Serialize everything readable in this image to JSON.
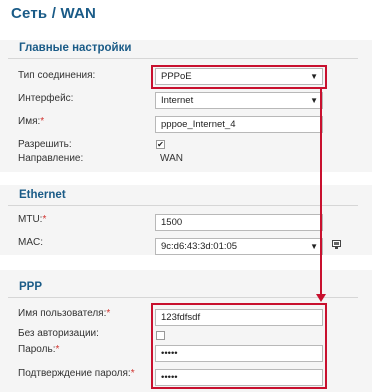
{
  "header": {
    "title": "Сеть /  WAN"
  },
  "main_settings": {
    "title": "Главные настройки",
    "connection_type": {
      "label": "Тип соединения:",
      "value": "PPPoE"
    },
    "interface": {
      "label": "Интерфейс:",
      "value": "Internet"
    },
    "name": {
      "label": "Имя:",
      "required_mark": "*",
      "value": "pppoe_Internet_4"
    },
    "allow": {
      "label": "Разрешить:",
      "checked": true,
      "check_glyph": "✔"
    },
    "direction": {
      "label": "Направление:",
      "value": "WAN"
    }
  },
  "ethernet": {
    "title": "Ethernet",
    "mtu": {
      "label": "MTU:",
      "required_mark": "*",
      "value": "1500"
    },
    "mac": {
      "label": "MAC:",
      "value": "9c:d6:43:3d:01:05",
      "icon": "network-card-icon"
    }
  },
  "ppp": {
    "title": "PPP",
    "username": {
      "label": "Имя пользователя:",
      "required_mark": "*",
      "value": "123fdfsdf"
    },
    "no_auth": {
      "label": "Без авторизации:",
      "checked": false
    },
    "password": {
      "label": "Пароль:",
      "required_mark": "*",
      "value": "•••••"
    },
    "password_confirm": {
      "label": "Подтверждение пароля:",
      "required_mark": "*",
      "value": "•••••"
    }
  },
  "icons": {
    "dropdown_arrow": "▼"
  },
  "colors": {
    "title": "#1a5b87",
    "required": "#d0312d",
    "highlight": "#c8102e",
    "section_background": "#f5f5f5"
  }
}
